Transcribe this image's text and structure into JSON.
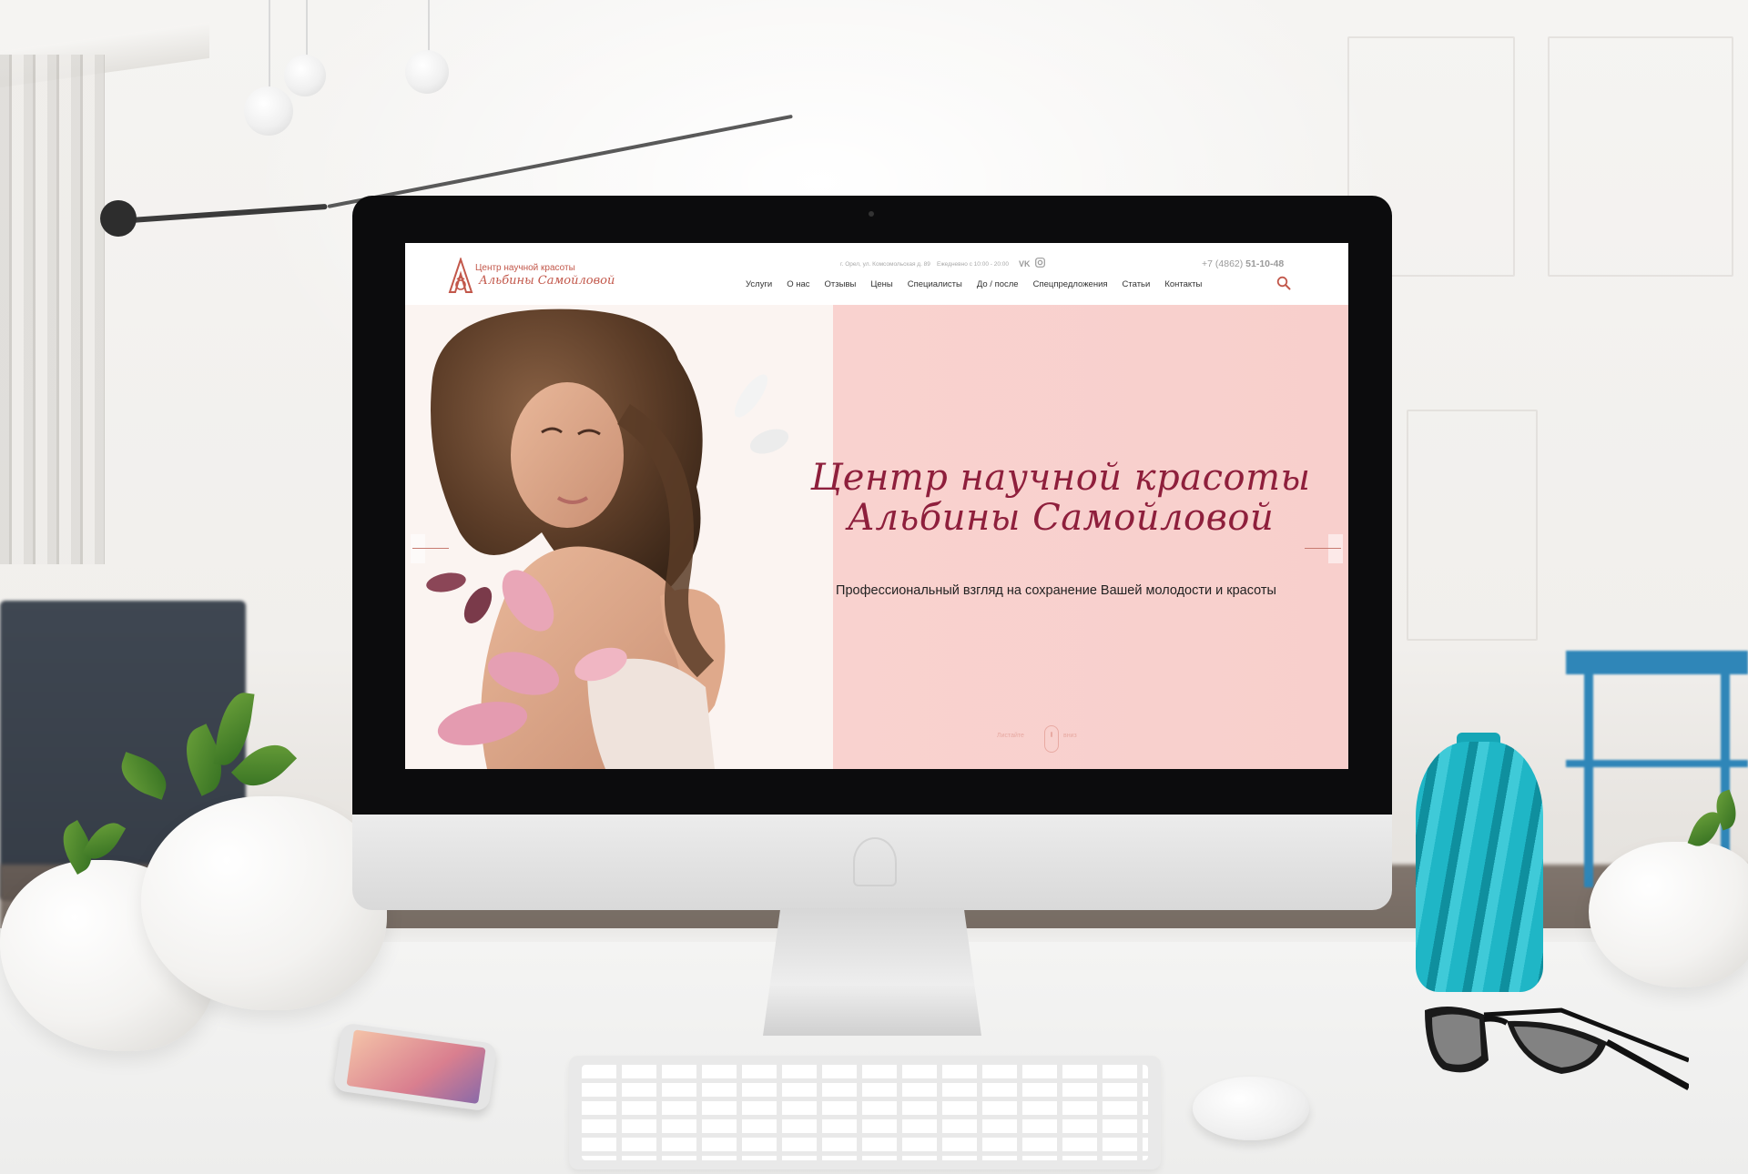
{
  "colors": {
    "accent": "#c2574a",
    "hero_title": "#8e1f3c",
    "hero_bg": "#f9d2cf",
    "vase": "#1fb6c6"
  },
  "site": {
    "logo": {
      "line1": "Центр научной красоты",
      "line2": "Альбины Самойловой"
    },
    "topbar": {
      "address": "г. Орел, ул. Комсомольская д. 89",
      "hours": "Ежедневно с 10:00 - 20:00",
      "social": [
        "vk-icon",
        "instagram-icon"
      ],
      "phone_prefix": "+7 (4862) ",
      "phone_number": "51-10-48"
    },
    "nav": [
      "Услуги",
      "О нас",
      "Отзывы",
      "Цены",
      "Специалисты",
      "До / после",
      "Спецпредложения",
      "Статьи",
      "Контакты"
    ],
    "hero": {
      "title_line1": "Центр научной красоты",
      "title_line2": "Альбины Самойловой",
      "subtitle": "Профессиональный взгляд на сохранение Вашей молодости и красоты",
      "scroll_left": "Листайте",
      "scroll_right": "вниз"
    }
  }
}
